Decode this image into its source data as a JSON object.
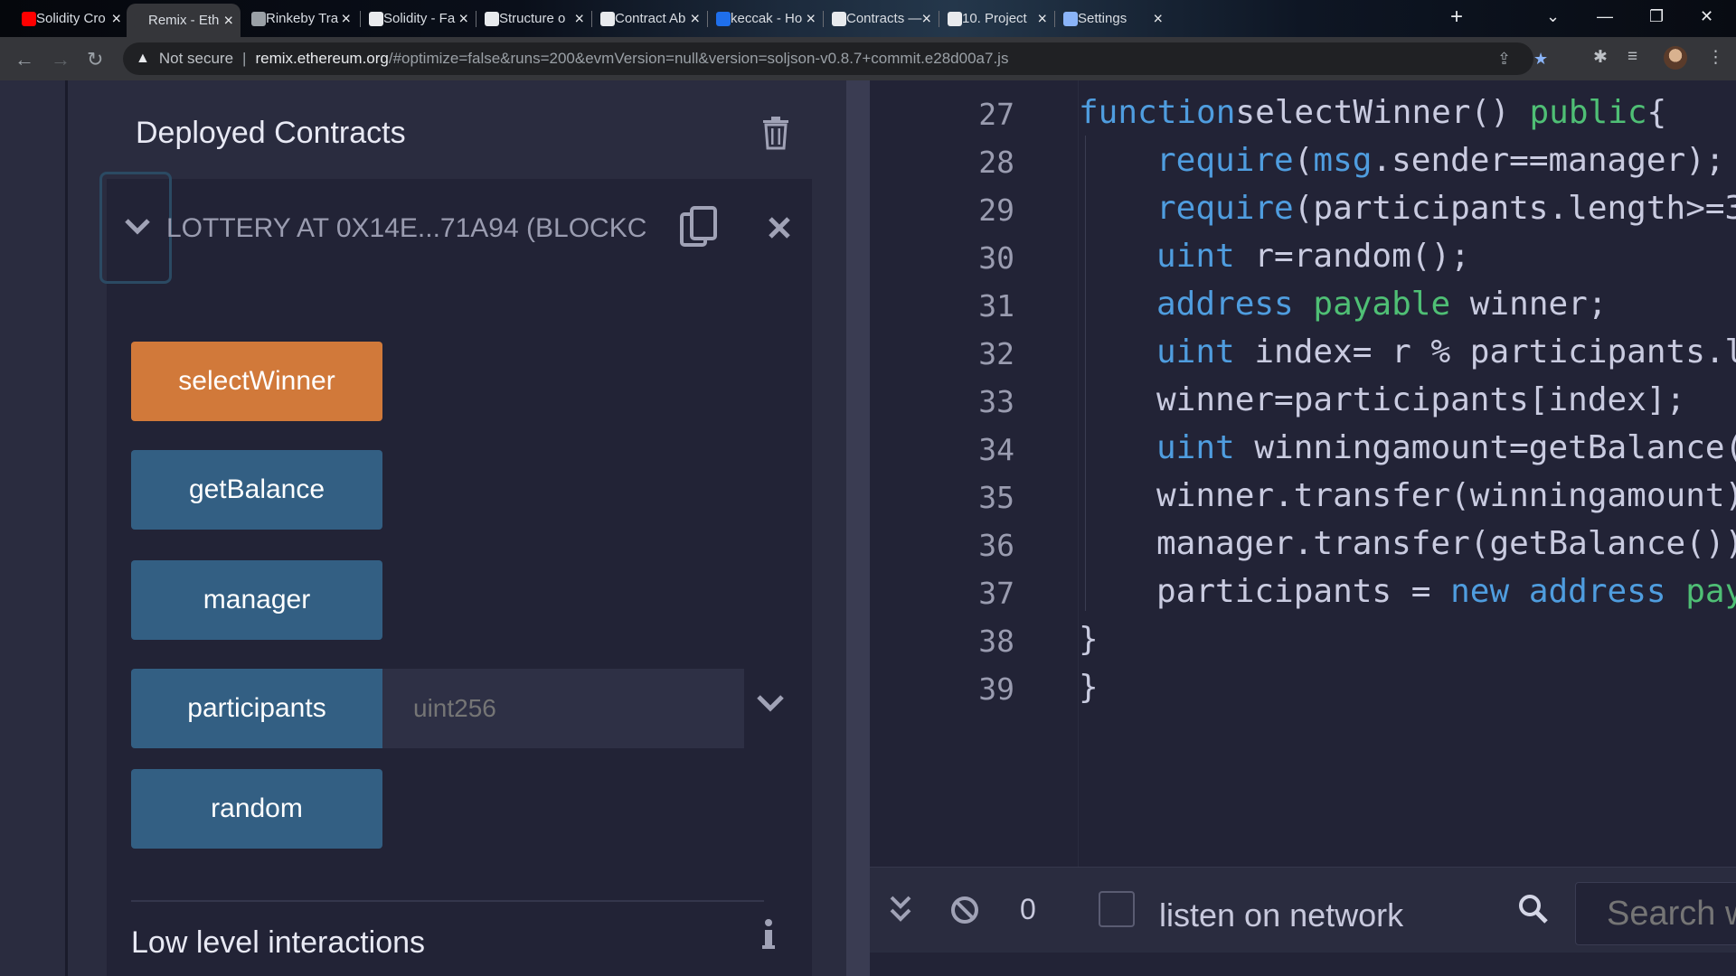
{
  "browser": {
    "tabs": [
      {
        "title": "Solidity Cro",
        "icon": "youtube-icon",
        "color": "#ff0000"
      },
      {
        "title": "Remix - Eth",
        "icon": "remix-icon",
        "color": "#35363a",
        "active": true
      },
      {
        "title": "Rinkeby Tra",
        "icon": "etherscan-icon",
        "color": "#9aa0a6"
      },
      {
        "title": "Solidity - Fa",
        "icon": "solidity-icon",
        "color": "#e8eaed"
      },
      {
        "title": "Structure o",
        "icon": "docs-icon",
        "color": "#e8eaed"
      },
      {
        "title": "Contract Ab",
        "icon": "docs-icon",
        "color": "#e8eaed"
      },
      {
        "title": "keccak - Ho",
        "icon": "eth-icon",
        "color": "#1f6feb"
      },
      {
        "title": "Contracts —",
        "icon": "docs-icon",
        "color": "#e8eaed"
      },
      {
        "title": "10. Project",
        "icon": "wordpress-icon",
        "color": "#e8eaed"
      },
      {
        "title": "Settings",
        "icon": "gear-icon",
        "color": "#8ab4f8"
      }
    ],
    "address": {
      "security_label": "Not secure",
      "host": "remix.ethereum.org",
      "path": "/#optimize=false&runs=200&evmVersion=null&version=soljson-v0.8.7+commit.e28d00a7.js"
    }
  },
  "panel": {
    "title": "Deployed Contracts",
    "instance_label": "LOTTERY AT 0X14E...71A94 (BLOCKC",
    "functions": [
      {
        "label": "selectWinner",
        "kind": "transact"
      },
      {
        "label": "getBalance",
        "kind": "call"
      },
      {
        "label": "manager",
        "kind": "call"
      },
      {
        "label": "participants",
        "kind": "call",
        "input_placeholder": "uint256"
      },
      {
        "label": "random",
        "kind": "call"
      }
    ],
    "low_level_title": "Low level interactions"
  },
  "editor": {
    "lines": [
      {
        "num": "27",
        "indent": 0,
        "tokens": [
          [
            "kw",
            "function"
          ],
          [
            "",
            "selectWinner() "
          ],
          [
            "gr",
            "public"
          ],
          [
            "",
            "{"
          ]
        ]
      },
      {
        "num": "28",
        "indent": 1,
        "tokens": [
          [
            "ty",
            "require"
          ],
          [
            "",
            "("
          ],
          [
            "ty",
            "msg"
          ],
          [
            "",
            ".sender==manager);"
          ]
        ]
      },
      {
        "num": "29",
        "indent": 1,
        "tokens": [
          [
            "ty",
            "require"
          ],
          [
            "",
            "(participants.length>=3"
          ]
        ]
      },
      {
        "num": "30",
        "indent": 1,
        "tokens": [
          [
            "ty",
            "uint"
          ],
          [
            "",
            " r=random();"
          ]
        ]
      },
      {
        "num": "31",
        "indent": 1,
        "tokens": [
          [
            "ty",
            "address"
          ],
          [
            "",
            " "
          ],
          [
            "gr",
            "payable"
          ],
          [
            "",
            " winner;"
          ]
        ]
      },
      {
        "num": "32",
        "indent": 1,
        "tokens": [
          [
            "ty",
            "uint"
          ],
          [
            "",
            " index= r % participants.l"
          ]
        ]
      },
      {
        "num": "33",
        "indent": 1,
        "tokens": [
          [
            "",
            "winner=participants[index];"
          ]
        ]
      },
      {
        "num": "34",
        "indent": 1,
        "tokens": [
          [
            "ty",
            "uint"
          ],
          [
            "",
            " winningamount=getBalance("
          ]
        ]
      },
      {
        "num": "35",
        "indent": 1,
        "tokens": [
          [
            "",
            "winner.transfer(winningamount)"
          ]
        ]
      },
      {
        "num": "36",
        "indent": 1,
        "tokens": [
          [
            "",
            "manager.transfer(getBalance())"
          ]
        ]
      },
      {
        "num": "37",
        "indent": 1,
        "tokens": [
          [
            "",
            "participants = "
          ],
          [
            "ty",
            "new"
          ],
          [
            "",
            " "
          ],
          [
            "ty",
            "address"
          ],
          [
            "",
            " "
          ],
          [
            "gr",
            "pay"
          ]
        ]
      },
      {
        "num": "38",
        "indent": 0,
        "tokens": [
          [
            "",
            "}"
          ]
        ]
      },
      {
        "num": "39",
        "indent": 0,
        "tokens": [
          [
            "",
            "}"
          ]
        ]
      }
    ]
  },
  "terminal": {
    "pending_count": "0",
    "listen_label": "listen on network",
    "search_placeholder": "Search w"
  },
  "colors": {
    "transact_button": "#d1793a",
    "call_button": "#335f83",
    "keyword": "#4f9ddf",
    "modifier": "#4fbf75"
  }
}
